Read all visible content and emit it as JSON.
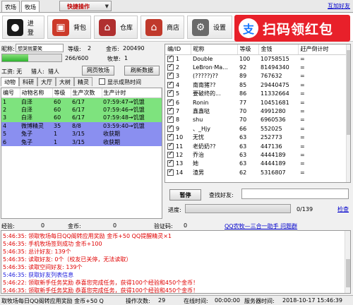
{
  "top_tabs": [
    {
      "label": "农场",
      "active": false
    },
    {
      "label": "牧场",
      "active": true
    }
  ],
  "quick_ops": "快捷操作",
  "friend_link": "互加好友",
  "toolbar": [
    {
      "label": "进登",
      "icon": "qq-penguin-icon",
      "color": "#1a1a1a"
    },
    {
      "label": "背包",
      "icon": "backpack-icon",
      "color": "#cc3a2a"
    },
    {
      "label": "仓库",
      "icon": "warehouse-icon",
      "color": "#b03030"
    },
    {
      "label": "商店",
      "icon": "shop-icon",
      "color": "#c0392b"
    },
    {
      "label": "设置",
      "icon": "settings-cow-icon",
      "color": "#6a6a6a"
    }
  ],
  "banner": {
    "logo": "支",
    "text": "扫码领红包"
  },
  "info": {
    "nickname_label": "昵称:",
    "nickname": "想哭就要笑",
    "level_label": "等级:",
    "level": "2",
    "gold_label": "金币:",
    "gold": "200490",
    "exp_text": "266/600",
    "exp_fraction": 0.44,
    "grass_label": "牧草:",
    "grass": "1",
    "job_label": "工资: 无",
    "hunter_label": "猎人:",
    "hunter": "猎人",
    "web_pasture_btn": "网页牧场",
    "refresh_btn": "刷新数据"
  },
  "sub_tabs": [
    "动物",
    "科研",
    "大厅",
    "大树",
    "精灵"
  ],
  "show_mature_label": "显示成熟时间",
  "animal_table": {
    "headers": [
      "编号",
      "动物名称",
      "等级",
      "生产次数",
      "生产计时"
    ],
    "rows": [
      {
        "cells": [
          "1",
          "白泽",
          "60",
          "6/17",
          "07:59:47→饥饿"
        ],
        "style": "green"
      },
      {
        "cells": [
          "2",
          "白泽",
          "60",
          "6/17",
          "07:59:46→饥饿"
        ],
        "style": "green"
      },
      {
        "cells": [
          "3",
          "白泽",
          "60",
          "6/17",
          "07:59:48→饥饿"
        ],
        "style": "green"
      },
      {
        "cells": [
          "4",
          "微博精灵",
          "35",
          "8/8",
          "03:59:40→饥饿"
        ],
        "style": "blue"
      },
      {
        "cells": [
          "5",
          "兔子",
          "1",
          "3/15",
          "收获期"
        ],
        "style": "blue"
      },
      {
        "cells": [
          "6",
          "兔子",
          "1",
          "3/15",
          "收获期"
        ],
        "style": "blue"
      }
    ]
  },
  "friend_table": {
    "headers": [
      "编/ID",
      "昵称",
      "等级",
      "金钱",
      "赶产倒计时"
    ],
    "rows": [
      [
        "1",
        "Double",
        "100",
        "10758515",
        "="
      ],
      [
        "2",
        "LeBron·Ma...",
        "92",
        "81494340",
        "="
      ],
      [
        "3",
        "(?????)??",
        "89",
        "767632",
        "="
      ],
      [
        "4",
        "南南猪??",
        "85",
        "29440475",
        "="
      ],
      [
        "5",
        "要破终的...",
        "86",
        "11332664",
        "="
      ],
      [
        "6",
        "Ronin",
        "77",
        "10451681",
        "="
      ],
      [
        "7",
        "鑫鑫哒",
        "70",
        "4991280",
        "="
      ],
      [
        "8",
        "shu",
        "70",
        "6960536",
        "="
      ],
      [
        "9",
        "、_Hjy",
        "66",
        "552025",
        "="
      ],
      [
        "10",
        "无忧",
        "63",
        "252773",
        "="
      ],
      [
        "11",
        "老奶奶??",
        "63",
        "447136",
        "="
      ],
      [
        "12",
        "乔治",
        "63",
        "4444189",
        "="
      ],
      [
        "13",
        "她",
        "63",
        "4444189",
        "="
      ],
      [
        "14",
        "渣男",
        "62",
        "5316807",
        "="
      ]
    ]
  },
  "pause_btn": "暂停",
  "search_label": "查找好友:",
  "progress_label": "进度:",
  "progress_text": "0/139",
  "check_link": "检查",
  "mid_strip": {
    "exp_label": "经验:",
    "exp_value": "0",
    "gold_label": "金币:",
    "gold_value": "0",
    "qq_link": "QQ农牧—三合一助手 问题群",
    "captcha_label": "验证码:",
    "captcha_value": "0"
  },
  "log": [
    {
      "text": "5:46:35: 领取牧场每日QQ阁转应用奖励 金币+50 QQ提醒精灵×1",
      "style": "red"
    },
    {
      "text": "5:46:35: 手机牧场签到成功 金币+100",
      "style": "red"
    },
    {
      "text": "5:46:35: 总计好友: 139个",
      "style": "red"
    },
    {
      "text": "5:46:35: 读取好友: 0个（校友已关停，无法读取）",
      "style": "red"
    },
    {
      "text": "5:46:35: 读取空间好友: 139个",
      "style": "red"
    },
    {
      "text": "5:46:35: 获取好友列表信息",
      "style": "blue"
    },
    {
      "text": "5:46:22: 领取新手任务奖励 恭喜您完成任务，获得100个经验和450个金币！",
      "style": "red"
    },
    {
      "text": "5:46:35: 领取新手任务奖励 恭喜您完成任务，获得100个经验和450个金币！",
      "style": "red"
    }
  ],
  "status": {
    "scroll_text": "取牧场每日QQ阁转应用奖励 金币+50 Q",
    "ops_label": "操作次数:",
    "ops_value": "29",
    "online_label": "在线时间:",
    "online_value": "00:00:00",
    "server_label": "服务器时间:",
    "server_value": "2018-10-17 15:46:39"
  }
}
